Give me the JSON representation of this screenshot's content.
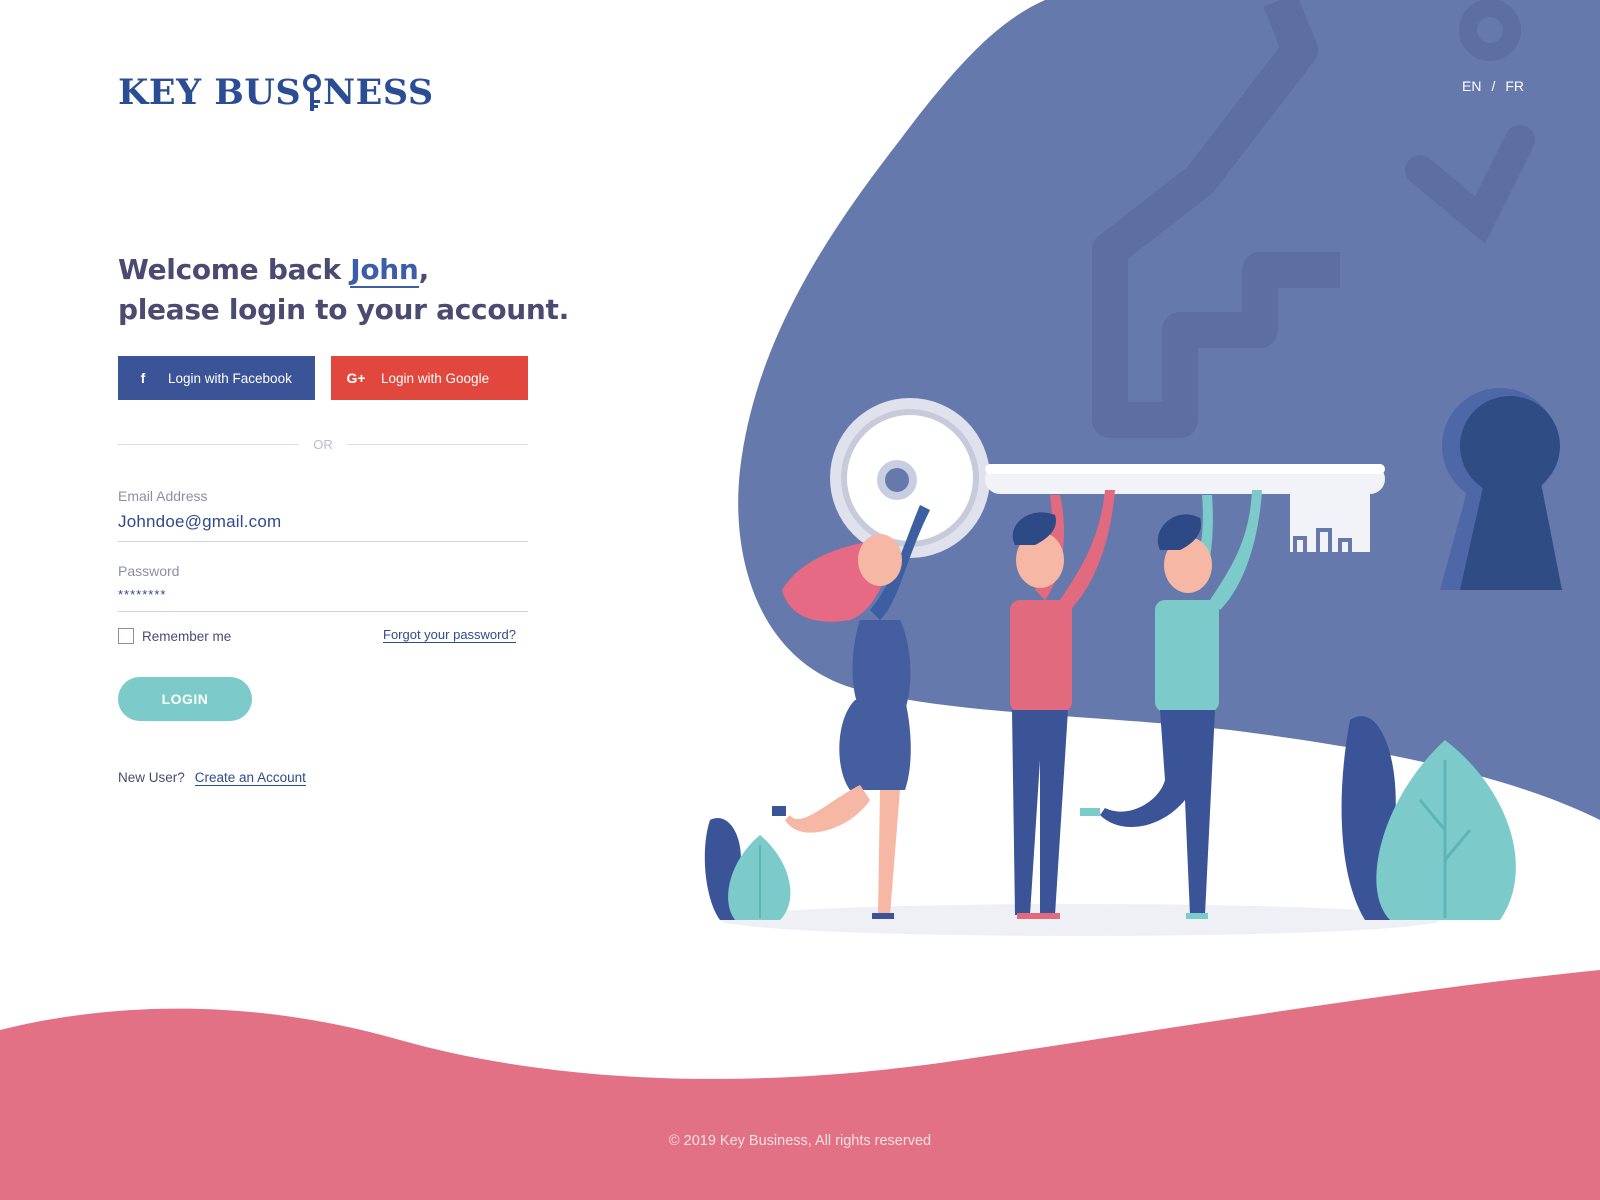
{
  "brand": {
    "name_part1": "KEY BUS",
    "name_part2": "NESS",
    "logo_color": "#2b4d94"
  },
  "language": {
    "options": [
      "EN",
      "FR"
    ],
    "separator": "/"
  },
  "heading": {
    "line1_prefix": "Welcome back ",
    "user_name": "John",
    "line1_suffix": ",",
    "line2": "please login to your account."
  },
  "social": {
    "facebook_label": "Login with Facebook",
    "facebook_icon": "facebook-icon",
    "google_label": "Login with Google",
    "google_icon": "google-plus-icon"
  },
  "divider": {
    "label": "OR"
  },
  "form": {
    "email_label": "Email Address",
    "email_value": "Johndoe@gmail.com",
    "password_label": "Password",
    "password_value": "********",
    "remember_label": "Remember me",
    "remember_checked": false,
    "forgot_label": "Forgot your password?",
    "login_label": "LOGIN"
  },
  "signup": {
    "prompt": "New User?",
    "link": "Create an Account"
  },
  "footer": {
    "copyright": "© 2019 Key Business, All rights reserved"
  },
  "colors": {
    "blob_blue": "#6679ad",
    "pink_wave": "#e37186",
    "facebook": "#3a5497",
    "google": "#e2473d",
    "login_button": "#7ccbca",
    "accent": "#2f4a8e"
  }
}
